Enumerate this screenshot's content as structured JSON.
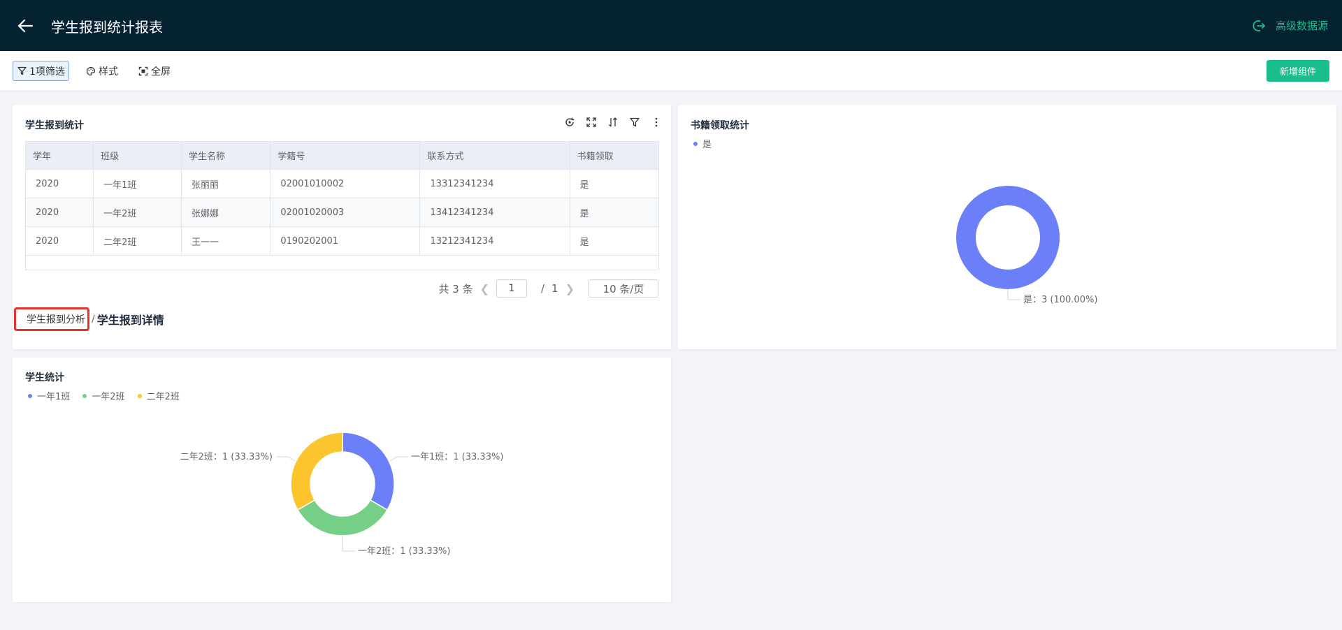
{
  "header": {
    "title": "学生报到统计报表",
    "source_button": "高级数据源"
  },
  "toolbar": {
    "filter_label": "1项筛选",
    "style_label": "样式",
    "fullscreen_label": "全屏",
    "add_widget_label": "新增组件"
  },
  "table_card": {
    "title": "学生报到统计",
    "columns": [
      "学年",
      "班级",
      "学生名称",
      "学籍号",
      "联系方式",
      "书籍领取"
    ],
    "rows": [
      [
        "2020",
        "一年1班",
        "张丽丽",
        "02001010002",
        "13312341234",
        "是"
      ],
      [
        "2020",
        "一年2班",
        "张娜娜",
        "02001020003",
        "13412341234",
        "是"
      ],
      [
        "2020",
        "二年2班",
        "王一一",
        "0190202001",
        "13212341234",
        "是"
      ]
    ],
    "pagination": {
      "total_text": "共 3 条",
      "current_page": "1",
      "separator": "/",
      "total_pages": "1",
      "page_size": "10 条/页"
    },
    "breadcrumb": {
      "link": "学生报到分析",
      "separator": "/",
      "current": "学生报到详情"
    }
  },
  "colors": {
    "header_bg": "#052233",
    "accent": "#19be8c",
    "blue": "#6b80f8",
    "green": "#76cf87",
    "yellow": "#fcc52e"
  },
  "chart_data": [
    {
      "type": "pie",
      "title": "书籍领取统计",
      "legend_position": "top-left",
      "categories": [
        "是"
      ],
      "values": [
        3
      ],
      "labels": [
        "是：3 (100.00%)"
      ],
      "colors": [
        "#6b80f8"
      ]
    },
    {
      "type": "pie",
      "title": "学生统计",
      "legend_position": "top-left",
      "categories": [
        "一年1班",
        "一年2班",
        "二年2班"
      ],
      "values": [
        1,
        1,
        1
      ],
      "labels": [
        "一年1班：1 (33.33%)",
        "一年2班：1 (33.33%)",
        "二年2班：1 (33.33%)"
      ],
      "colors": [
        "#6b80f8",
        "#76cf87",
        "#fcc52e"
      ]
    }
  ]
}
